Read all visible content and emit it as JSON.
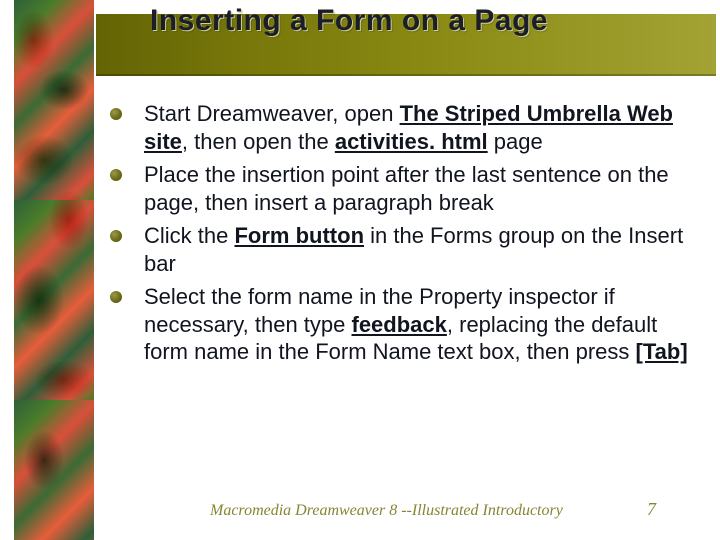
{
  "title": "Inserting a Form on a Page",
  "bullets": [
    {
      "segments": [
        {
          "t": "Start Dreamweaver, open "
        },
        {
          "t": "The Striped Umbrella Web site",
          "b": true,
          "u": true
        },
        {
          "t": ", then open the "
        },
        {
          "t": "activities. html",
          "b": true,
          "u": true
        },
        {
          "t": " page"
        }
      ]
    },
    {
      "segments": [
        {
          "t": "Place the insertion point after the last sentence on the page, then insert a paragraph break"
        }
      ]
    },
    {
      "segments": [
        {
          "t": "Click the "
        },
        {
          "t": "Form button",
          "b": true,
          "u": true
        },
        {
          "t": " in the Forms group on the Insert bar"
        }
      ]
    },
    {
      "segments": [
        {
          "t": "Select the form name in the Property inspector if necessary, then type "
        },
        {
          "t": "feedback",
          "b": true,
          "u": true
        },
        {
          "t": ", replacing the default form name in the Form Name text box, then press "
        },
        {
          "t": "[Tab]",
          "b": true,
          "u": true
        }
      ]
    }
  ],
  "footer": "Macromedia Dreamweaver 8 --Illustrated Introductory",
  "page_number": "7"
}
